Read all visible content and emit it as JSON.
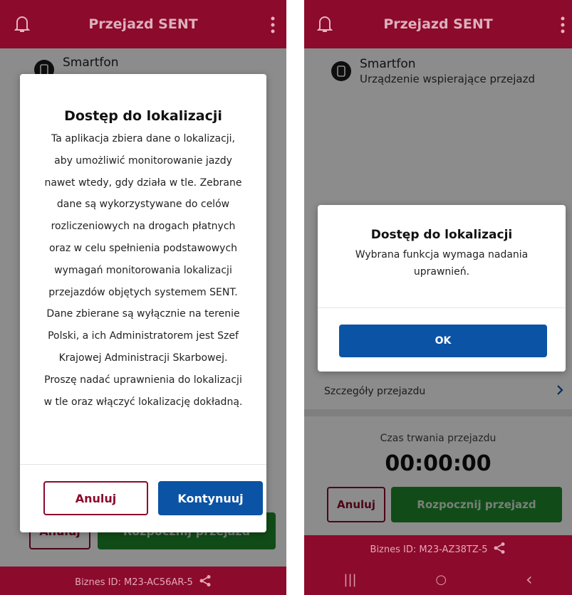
{
  "left": {
    "topbar": {
      "title": "Przejazd SENT"
    },
    "device": {
      "name": "Smartfon"
    },
    "dialog": {
      "title": "Dostęp do lokalizacji",
      "body_lines": [
        "Ta aplikacja zbiera dane o lokalizacji,",
        "aby umożliwić monitorowanie jazdy",
        "nawet wtedy, gdy działa w tle. Zebrane",
        "dane są wykorzystywane do celów",
        "rozliczeniowych na drogach płatnych",
        "oraz w celu spełnienia podstawowych",
        "wymagań monitorowania lokalizacji",
        "przejazdów objętych systemem SENT.",
        "Dane zbierane są wyłącznie na terenie",
        "Polski, a ich Administratorem jest Szef",
        "Krajowej Administracji Skarbowej.",
        "Proszę nadać uprawnienia do lokalizacji",
        "w tle oraz włączyć lokalizację dokładną."
      ],
      "cancel_label": "Anuluj",
      "continue_label": "Kontynuuj"
    },
    "behind": {
      "cancel_label": "Anuluj",
      "start_label": "Rozpocznij przejazd"
    },
    "footer": {
      "text": "Biznes ID:  M23-AC56AR-5"
    }
  },
  "right": {
    "topbar": {
      "title": "Przejazd SENT"
    },
    "device": {
      "name": "Smartfon",
      "subtitle": "Urządzenie wspierające przejazd"
    },
    "dialog": {
      "title": "Dostęp do lokalizacji",
      "body_lines": [
        "Wybrana funkcja wymaga nadania",
        "uprawnień."
      ],
      "ok_label": "OK"
    },
    "details": {
      "label": "Szczegóły przejazdu"
    },
    "duration": {
      "label": "Czas trwania przejazdu",
      "value": "00:00:00"
    },
    "buttons": {
      "cancel_label": "Anuluj",
      "start_label": "Rozpocznij przejazd"
    },
    "footer": {
      "text": "Biznes ID:  M23-AZ38TZ-5"
    },
    "navbar": {
      "recents": "|||",
      "home": "○",
      "back": "‹"
    }
  },
  "colors": {
    "brand": "#8c0a2c",
    "primary": "#0b53a5",
    "success": "#1f8a2c"
  }
}
